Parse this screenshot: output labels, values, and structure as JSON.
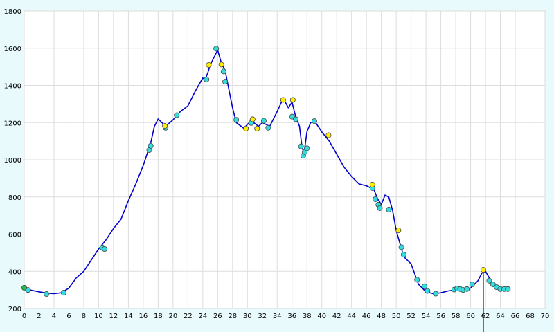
{
  "chart_data": {
    "type": "line",
    "title": "",
    "xlabel": "",
    "ylabel": "",
    "xlim": [
      0,
      70
    ],
    "ylim": [
      200,
      1800
    ],
    "grid": true,
    "x_ticks": [
      "0",
      "2",
      "4",
      "6",
      "8",
      "10",
      "12",
      "14",
      "16",
      "18",
      "20",
      "22",
      "24",
      "26",
      "28",
      "30",
      "32",
      "34",
      "36",
      "38",
      "40",
      "42",
      "44",
      "46",
      "48",
      "50",
      "52",
      "54",
      "56",
      "58",
      "60",
      "62",
      "64",
      "66",
      "68",
      "70"
    ],
    "y_ticks": [
      "200",
      "400",
      "600",
      "800",
      "1000",
      "1200",
      "1400",
      "1600",
      "1800"
    ],
    "series": [
      {
        "type": "line",
        "color": "#0000cc",
        "x": [
          0,
          1,
          2,
          3,
          4,
          5,
          6,
          7,
          8,
          9,
          10,
          11,
          12,
          13,
          14,
          15,
          16,
          17,
          17.5,
          18,
          19,
          20,
          21,
          22,
          23,
          24,
          24.3,
          24.7,
          25,
          25.5,
          26,
          26.5,
          27,
          27.5,
          28,
          28.5,
          29.5,
          30.5,
          31.5,
          32,
          33,
          34,
          34.8,
          35.5,
          36,
          36.5,
          37,
          37.3,
          37.6,
          38,
          38.5,
          39,
          40,
          41,
          42,
          43,
          44,
          45,
          46,
          47,
          47.5,
          48,
          48.5,
          49,
          49.5,
          50,
          51,
          52,
          53,
          54,
          55,
          56,
          57,
          58,
          59,
          60,
          61,
          61.5,
          62,
          63,
          64,
          65
        ],
        "y": [
          310,
          298,
          290,
          283,
          280,
          285,
          310,
          365,
          400,
          460,
          520,
          570,
          630,
          680,
          780,
          870,
          970,
          1090,
          1180,
          1220,
          1180,
          1215,
          1260,
          1290,
          1370,
          1440,
          1430,
          1470,
          1510,
          1550,
          1590,
          1520,
          1480,
          1380,
          1280,
          1200,
          1170,
          1210,
          1180,
          1200,
          1180,
          1260,
          1330,
          1280,
          1310,
          1230,
          1180,
          1080,
          1030,
          1150,
          1200,
          1210,
          1150,
          1100,
          1030,
          960,
          910,
          870,
          860,
          840,
          790,
          760,
          810,
          800,
          730,
          620,
          480,
          440,
          330,
          290,
          280,
          285,
          295,
          300,
          300,
          310,
          350,
          390,
          400,
          330,
          305,
          305
        ]
      },
      {
        "type": "scatter",
        "name": "cyan markers",
        "color": "#33dddd",
        "x": [
          0.5,
          3,
          5.3,
          10.5,
          10.8,
          16.8,
          17,
          19,
          20.5,
          24.5,
          25.8,
          26.8,
          27,
          28.5,
          30.5,
          32.2,
          32.8,
          36,
          36.5,
          37.2,
          37.5,
          37.7,
          38,
          39,
          46.8,
          47.2,
          47.6,
          47.8,
          49,
          50.7,
          51,
          52.8,
          53.8,
          54.2,
          55.3,
          57.8,
          58.2,
          58.6,
          59,
          59.5,
          60.2,
          62.5,
          63,
          63.5,
          64,
          64.5,
          65
        ],
        "y": [
          300,
          278,
          285,
          528,
          520,
          1052,
          1075,
          1172,
          1240,
          1432,
          1598,
          1475,
          1420,
          1215,
          1198,
          1210,
          1172,
          1232,
          1218,
          1072,
          1022,
          1042,
          1062,
          1208,
          848,
          788,
          758,
          740,
          732,
          530,
          490,
          355,
          320,
          295,
          280,
          302,
          308,
          305,
          300,
          305,
          330,
          350,
          330,
          315,
          305,
          305,
          305
        ]
      },
      {
        "type": "scatter",
        "name": "yellow markers",
        "color": "#ffee00",
        "x": [
          18.9,
          24.8,
          26.5,
          29.8,
          30.7,
          31.3,
          34.8,
          36.1,
          40.9,
          46.8,
          50.3,
          61.7
        ],
        "y": [
          1182,
          1510,
          1512,
          1168,
          1218,
          1168,
          1322,
          1322,
          1132,
          866,
          620,
          408
        ]
      },
      {
        "type": "scatter",
        "name": "green marker",
        "color": "#22bb44",
        "x": [
          0
        ],
        "y": [
          312
        ]
      }
    ],
    "marker_line": {
      "x": 61.7,
      "color": "#0000cc"
    }
  }
}
